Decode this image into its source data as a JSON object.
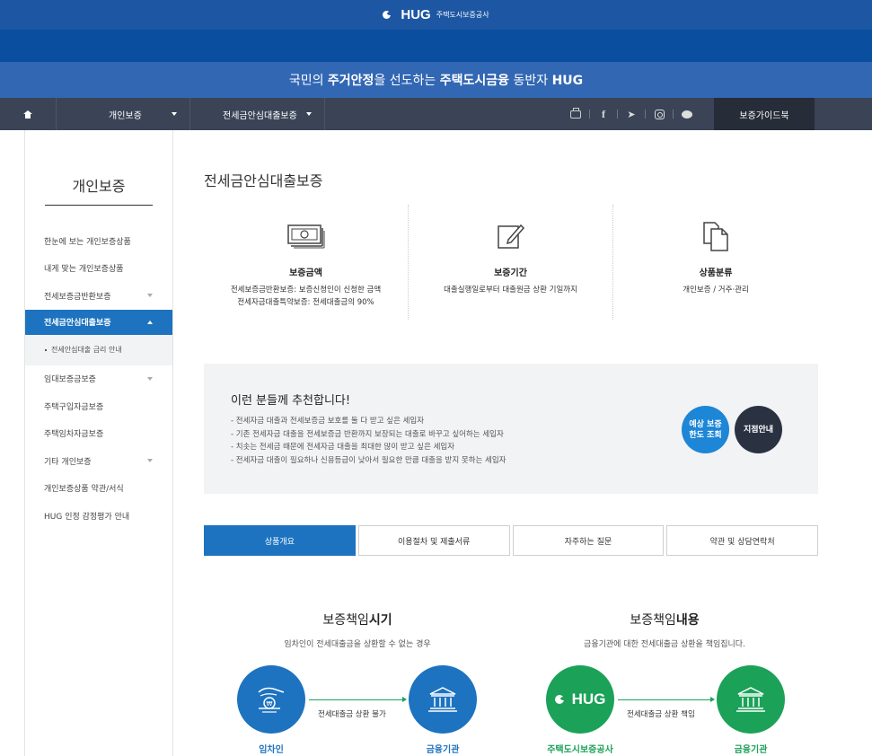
{
  "header": {
    "logo_text": "HUG",
    "logo_sub": "주택도시보증공사",
    "slogan_part1": "국민의 ",
    "slogan_bold1": "주거안정",
    "slogan_part2": "을 선도하는 ",
    "slogan_bold2": "주택도시금융",
    "slogan_part3": " 동반자 ",
    "slogan_bold3": "HUG"
  },
  "nav": {
    "dropdown1": "개인보증",
    "dropdown2": "전세금안심대출보증",
    "guide_button": "보증가이드북",
    "icons": [
      "printer-icon",
      "facebook-icon",
      "twitter-icon",
      "instagram-icon",
      "chat-icon"
    ]
  },
  "sidebar": {
    "title": "개인보증",
    "items": [
      {
        "label": "한눈에 보는 개인보증상품"
      },
      {
        "label": "내게 맞는 개인보증상품"
      },
      {
        "label": "전세보증금반환보증"
      },
      {
        "label": "전세금안심대출보증"
      },
      {
        "label": "전세안심대출 금리 안내"
      },
      {
        "label": "임대보증금보증"
      },
      {
        "label": "주택구입자금보증"
      },
      {
        "label": "주택임차자금보증"
      },
      {
        "label": "기타 개인보증"
      },
      {
        "label": "개인보증상품 약관/서식"
      },
      {
        "label": "HUG 인정 감정평가 안내"
      }
    ]
  },
  "main": {
    "title": "전세금안심대출보증",
    "summary": [
      {
        "head": "보증금액",
        "line1": "전세보증금반환보증: 보증신청인이 신청한 금액",
        "line2": "전세자금대출특약보증: 전세대출금의 90%"
      },
      {
        "head": "보증기간",
        "line1": "대출실행일로부터 대출원금 상환 기일까지",
        "line2": ""
      },
      {
        "head": "상품분류",
        "line1": "개인보증 / 거주·관리",
        "line2": ""
      }
    ],
    "recommend": {
      "title": "이런 분들께 추천합니다!",
      "items": [
        "- 전세자금 대출과 전세보증금 보호를 둘 다 받고 싶은 세입자",
        "- 기존 전세자금 대출을 전세보증금 반환까지 보장되는 대출로 바꾸고 싶어하는 세입자",
        "- 치솟는 전세금 때문에 전세자금 대출을 최대한 많이 받고 싶은 세입자",
        "- 전세자금 대출이 필요하나 신용등급이 낮아서 필요한 만큼 대출을 받지 못하는 세입자"
      ],
      "btn1_line1": "예상 보증",
      "btn1_line2": "한도 조회",
      "btn2": "지점안내"
    },
    "tabs": [
      {
        "label": "상품개요"
      },
      {
        "label": "이용절차 및 제출서류"
      },
      {
        "label": "자주하는 질문"
      },
      {
        "label": "약관 및 상담연락처"
      }
    ],
    "resp_time": {
      "title_plain": "보증책임",
      "title_bold": "시기",
      "subtitle": "임차인이 전세대출금을 상환할 수 없는 경우",
      "from": "임차인",
      "to": "금융기관",
      "arrow": "전세대출금 상환 불가"
    },
    "resp_content": {
      "title_plain": "보증책임",
      "title_bold": "내용",
      "subtitle": "금융기관에 대한 전세대출금 상환을 책임집니다.",
      "badge": "HUG",
      "from": "주택도시보증공사",
      "to": "금융기관",
      "arrow": "전세대출금 상환 책임"
    }
  }
}
